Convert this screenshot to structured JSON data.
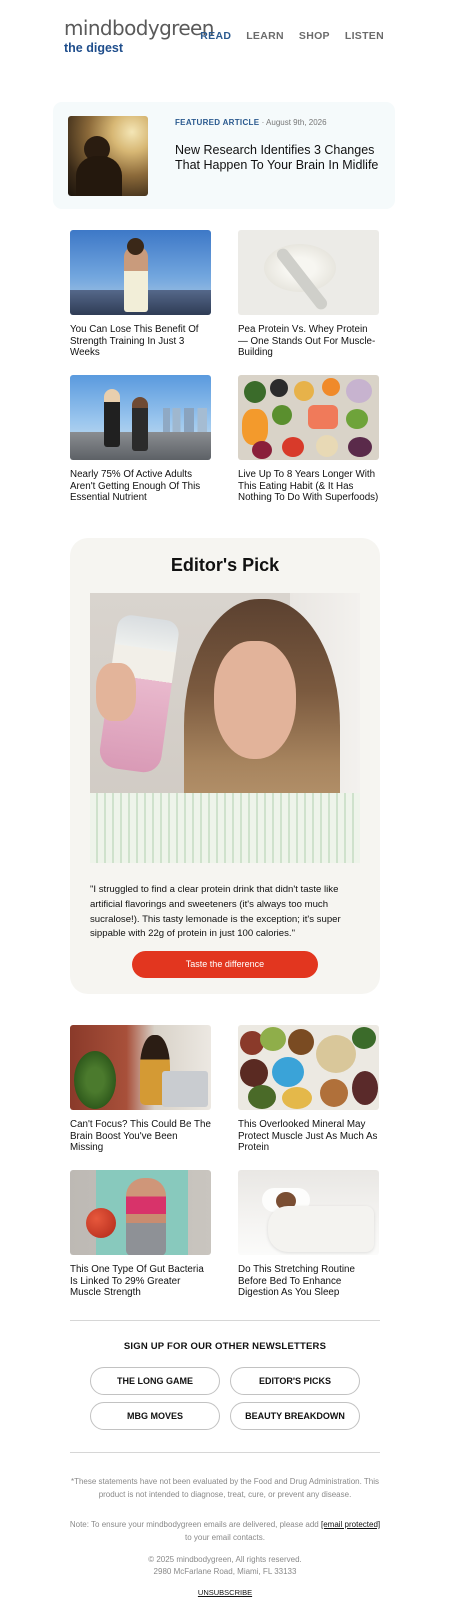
{
  "header": {
    "logo_word": "mindbodygreen",
    "logo_sub": "the digest",
    "nav": [
      "READ",
      "LEARN",
      "SHOP",
      "LISTEN"
    ]
  },
  "featured": {
    "label": "FEATURED ARTICLE",
    "date": "August 9th, 2026",
    "title": "New Research Identifies 3 Changes That Happen To Your Brain In Midlife"
  },
  "articles_top": [
    {
      "title": "You Can Lose This Benefit Of Strength Training In Just 3 Weeks"
    },
    {
      "title": "Pea Protein Vs. Whey Protein — One Stands Out For Muscle-Building"
    },
    {
      "title": "Nearly 75% Of Active Adults Aren't Getting Enough Of This Essential Nutrient"
    },
    {
      "title": "Live Up To 8 Years Longer With This Eating Habit (& It Has Nothing To Do With Superfoods)"
    }
  ],
  "editor": {
    "title": "Editor's Pick",
    "quote": "\"I struggled to find a clear protein drink that didn't taste like artificial flavorings and sweeteners (it's always too much sucralose!). This tasty lemonade is the exception; it's super sippable with 22g of protein in just 100 calories.\"",
    "button": "Taste the difference"
  },
  "articles_bottom": [
    {
      "title": "Can't Focus? This Could Be The Brain Boost You've Been Missing"
    },
    {
      "title": "This Overlooked Mineral May Protect Muscle Just As Much As Protein"
    },
    {
      "title": "This One Type Of Gut Bacteria Is Linked To 29% Greater Muscle Strength"
    },
    {
      "title": "Do This Stretching Routine Before Bed To Enhance Digestion As You Sleep"
    }
  ],
  "signup": {
    "title": "SIGN UP FOR OUR OTHER NEWSLETTERS",
    "options": [
      "THE LONG GAME",
      "EDITOR'S PICKS",
      "MBG MOVES",
      "BEAUTY BREAKDOWN"
    ]
  },
  "footer": {
    "disclaimer": "*These statements have not been evaluated by the Food and Drug Administration. This product is not intended to diagnose, treat, cure, or prevent any disease.",
    "note_prefix": "Note: To ensure your mindbodygreen emails are delivered, please add",
    "note_link": "[email protected]",
    "note_suffix": "to your email contacts.",
    "copyright": "© 2025 mindbodygreen, All rights reserved.",
    "address": "2980 McFarlane Road, Miami, FL 33133",
    "unsubscribe": "UNSUBSCRIBE"
  },
  "colors": {
    "brand_blue": "#2b5a8f",
    "cta_red": "#e2361f",
    "featured_bg": "#f5fafb",
    "editor_bg": "#f6f5f1"
  }
}
